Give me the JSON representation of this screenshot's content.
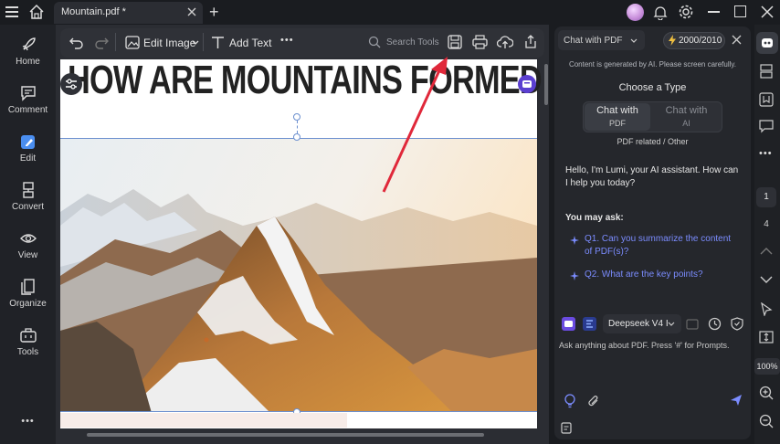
{
  "titlebar": {
    "tab_title": "Mountain.pdf *",
    "new_tab": "+"
  },
  "sidebar": {
    "items": [
      {
        "label": "Home",
        "icon": "rocket-icon"
      },
      {
        "label": "Comment",
        "icon": "comment-icon"
      },
      {
        "label": "Edit",
        "icon": "edit-icon"
      },
      {
        "label": "Convert",
        "icon": "convert-icon"
      },
      {
        "label": "View",
        "icon": "eye-icon"
      },
      {
        "label": "Organize",
        "icon": "organize-icon"
      },
      {
        "label": "Tools",
        "icon": "toolbox-icon"
      }
    ],
    "more": "•••"
  },
  "toolbar": {
    "edit_image": "Edit Image",
    "add_text": "Add Text",
    "more": "•••",
    "search_placeholder": "Search Tools"
  },
  "document": {
    "heading": "HOW ARE MOUNTAINS FORMED"
  },
  "ai_panel": {
    "mode": "Chat with PDF",
    "credits": "2000/2010",
    "notice": "Content is generated by AI. Please screen carefully.",
    "choose_title": "Choose a Type",
    "type_pdf_line1": "Chat with",
    "type_pdf_line2": "PDF",
    "type_ai_line1": "Chat with",
    "type_ai_line2": "AI",
    "type_caption": "PDF related / Other",
    "greeting": "Hello, I'm Lumi, your AI assistant. How can I help you today?",
    "you_may_ask": "You may ask:",
    "q1": "Q1. Can you summarize the content of PDF(s)?",
    "q2": "Q2. What are the key points?",
    "model": "Deepseek V4 I",
    "input_placeholder": "Ask anything about PDF. Press '#' for Prompts."
  },
  "rightbar": {
    "page_number": "1",
    "page_total": "4",
    "zoom": "100%"
  },
  "colors": {
    "accent": "#7b8cff",
    "arrow": "#e0283a",
    "credit": "#f0c040"
  }
}
